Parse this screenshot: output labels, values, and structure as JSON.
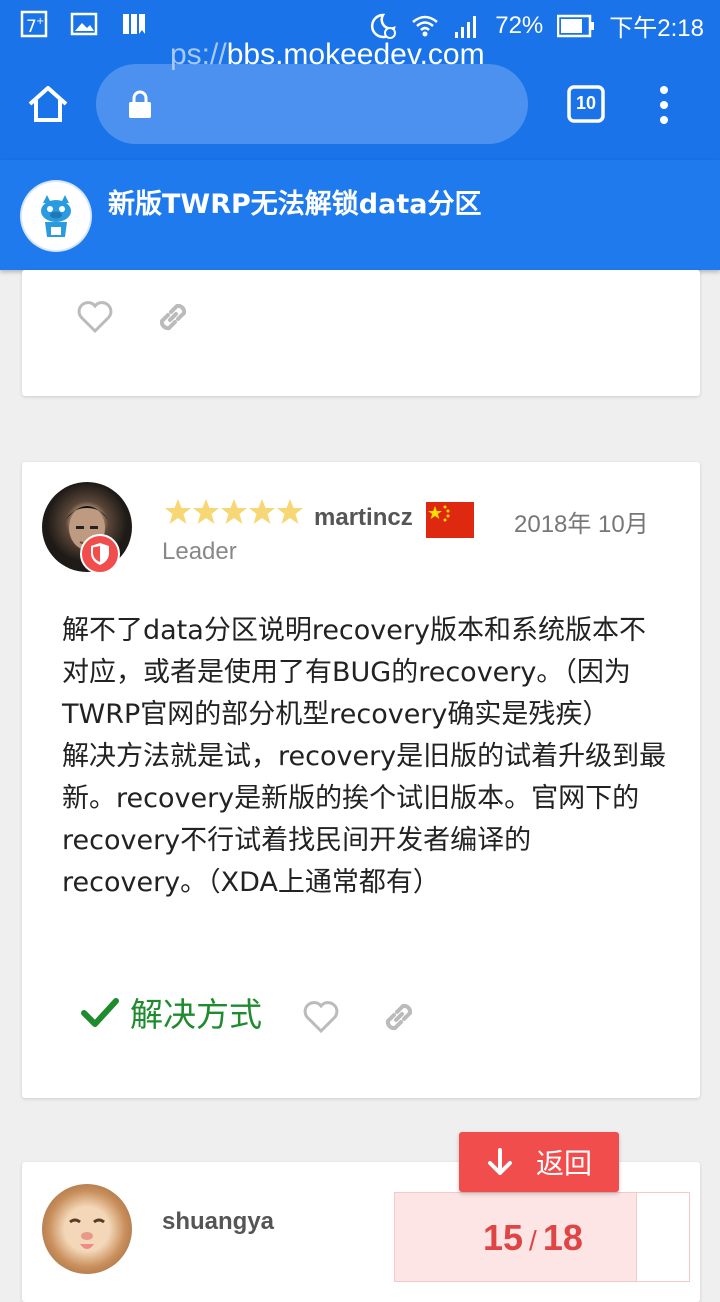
{
  "status_bar": {
    "battery": "72%",
    "time": "下午2:18"
  },
  "browser": {
    "url_faded": "ps://",
    "url_main": "bbs.mokeedev.com",
    "tab_count": "10"
  },
  "topic": {
    "title": "新版TWRP无法解锁data分区"
  },
  "post": {
    "username": "martincz",
    "date": "2018年 10月",
    "role": "Leader",
    "rating_stars": 5,
    "body_lines": [
      "解不了data分区说明recovery版本和系统版本不对应，或者是使用了有BUG的recovery。（因为TWRP官网的部分机型recovery确实是残疾）",
      "解决方法就是试，recovery是旧版的试着升级到最新。recovery是新版的挨个试旧版本。官网下的recovery不行试着找民间开发者编译的recovery。（XDA上通常都有）"
    ],
    "solution_label": "解决方式"
  },
  "next_post": {
    "username": "shuangya"
  },
  "navigation": {
    "back_label": "返回",
    "current_page": "15",
    "separator": "/",
    "total_pages": "18"
  },
  "colors": {
    "primary": "#1a73e8",
    "accent_red": "#f24d4d",
    "solution_green": "#1e8b2e",
    "star_yellow": "#f7d774"
  }
}
